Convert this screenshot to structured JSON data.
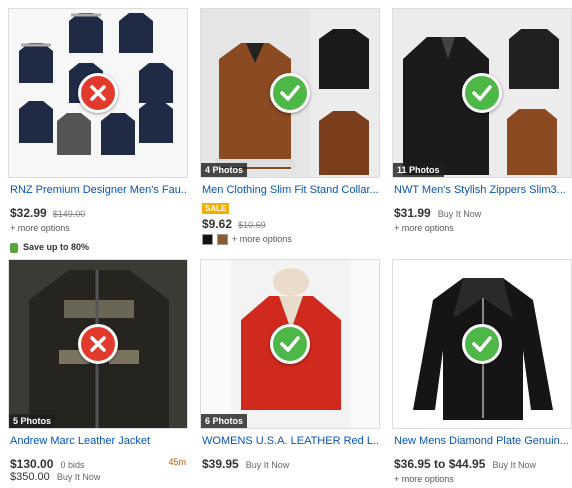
{
  "listings": [
    {
      "title": "RNZ Premium Designer Men's Fau...",
      "price": "$32.99",
      "old_price": "$149.00",
      "more_options": "+ more options",
      "savings": "Save up to 80%",
      "verdict": "cross-icon"
    },
    {
      "title": "Men Clothing Slim Fit Stand Collar...",
      "photos": "4 Photos",
      "sale_badge": "SALE",
      "price": "$9.62",
      "old_price": "$10.69",
      "more_options": "+ more options",
      "swatch_colors": [
        "#111111",
        "#8a5a2e"
      ],
      "verdict": "check-icon"
    },
    {
      "title": "NWT Men's Stylish Zippers Slim3...",
      "photos": "11 Photos",
      "price": "$31.99",
      "format": "Buy It Now",
      "more_options": "+ more options",
      "verdict": "check-icon"
    },
    {
      "title": "Andrew Marc Leather Jacket",
      "photos": "5 Photos",
      "price": "$130.00",
      "bids": "0 bids",
      "time_left": "45m",
      "bin_price": "$350.00",
      "format": "Buy It Now",
      "verdict": "cross-icon"
    },
    {
      "title": "WOMENS U.S.A. LEATHER Red L...",
      "photos": "6 Photos",
      "price": "$39.95",
      "format": "Buy It Now",
      "verdict": "check-icon"
    },
    {
      "title": "New Mens Diamond Plate Genuin...",
      "price": "$36.95 to $44.95",
      "format": "Buy It Now",
      "more_options": "+ more options",
      "verdict": "check-icon"
    }
  ],
  "colors": {
    "link": "#0654ba",
    "check": "#4db848",
    "cross": "#e23b2e",
    "sale": "#f5af02",
    "time_left": "#c45500"
  }
}
